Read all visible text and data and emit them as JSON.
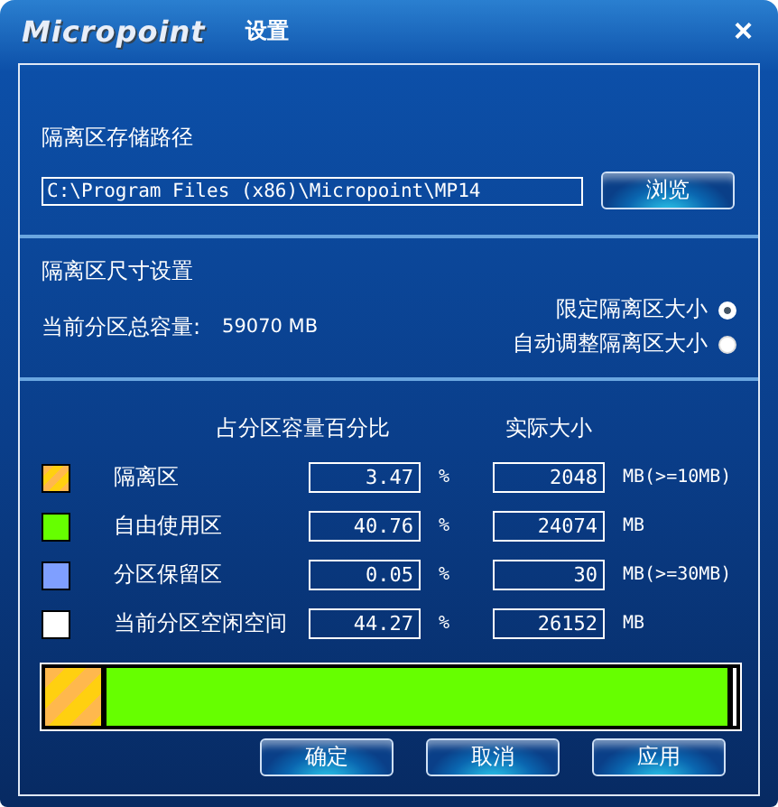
{
  "window": {
    "logo": "Micropoint",
    "title": "设置",
    "close": "×"
  },
  "storage": {
    "heading": "隔离区存储路径",
    "path": "C:\\Program Files (x86)\\Micropoint\\MP14",
    "browse": "浏览"
  },
  "size_settings": {
    "heading": "隔离区尺寸设置",
    "capacity_label": "当前分区总容量:",
    "capacity_value": "59070 MB",
    "options": [
      {
        "label": "限定隔离区大小",
        "selected": true
      },
      {
        "label": "自动调整隔离区大小",
        "selected": false
      }
    ]
  },
  "allocation": {
    "columns": [
      "占分区容量百分比",
      "实际大小"
    ],
    "rows": [
      {
        "kind": "striped",
        "color": "#ffb84d",
        "name": "隔离区",
        "percent": "3.47",
        "percent_unit": "%",
        "size": "2048",
        "size_unit": "MB(>=10MB)"
      },
      {
        "kind": "solid",
        "color": "#66ff00",
        "name": "自由使用区",
        "percent": "40.76",
        "percent_unit": "%",
        "size": "24074",
        "size_unit": "MB"
      },
      {
        "kind": "solid",
        "color": "#7f9fff",
        "name": "分区保留区",
        "percent": "0.05",
        "percent_unit": "%",
        "size": "30",
        "size_unit": "MB(>=30MB)"
      },
      {
        "kind": "solid",
        "color": "#ffffff",
        "name": "当前分区空闲空间",
        "percent": "44.27",
        "percent_unit": "%",
        "size": "26152",
        "size_unit": "MB"
      }
    ],
    "bar": [
      {
        "kind": "striped",
        "color": "#ffb84d",
        "level": 0.08
      },
      {
        "kind": "solid",
        "color": "#66ff00",
        "level": 0.9
      }
    ]
  },
  "buttons": [
    "确定",
    "取消",
    "应用"
  ]
}
